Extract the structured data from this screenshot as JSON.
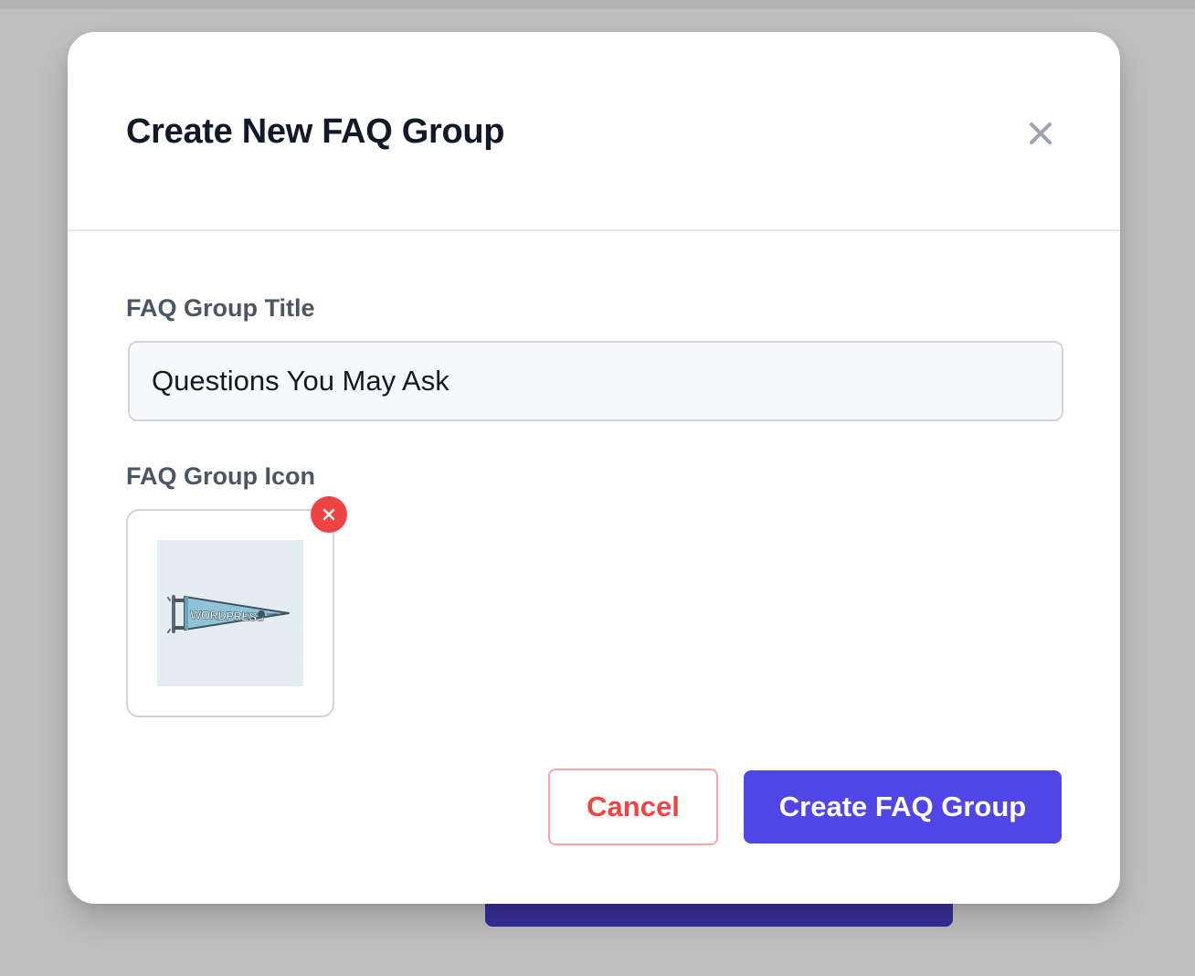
{
  "modal": {
    "title": "Create New FAQ Group",
    "close_icon": "close-icon"
  },
  "form": {
    "title_label": "FAQ Group Title",
    "title_value": "Questions You May Ask",
    "icon_label": "FAQ Group Icon",
    "icon_image": "wordpress-pennant-image",
    "icon_image_text": "WORDPRESS",
    "remove_icon": "remove-icon"
  },
  "actions": {
    "cancel_label": "Cancel",
    "create_label": "Create FAQ Group"
  },
  "colors": {
    "primary": "#4f46e5",
    "danger": "#ef4444",
    "title_text": "#111827",
    "label_text": "#4b5563",
    "backdrop": "#c0c0c0"
  }
}
